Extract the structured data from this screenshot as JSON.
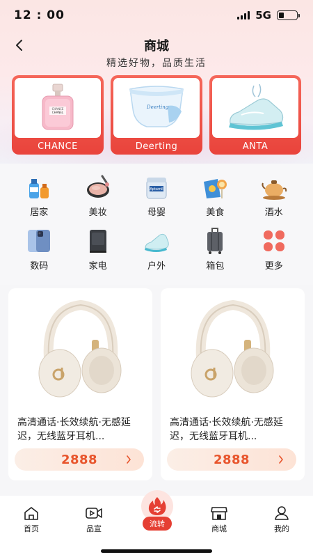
{
  "status_bar": {
    "time": "12 : 00",
    "network": "5G"
  },
  "header": {
    "title": "商城",
    "subtitle": "精选好物，品质生活"
  },
  "brands": [
    {
      "label": "CHANCE",
      "icon": "perfume-bottle-image"
    },
    {
      "label": "Deerting",
      "icon": "diaper-image"
    },
    {
      "label": "ANTA",
      "icon": "sneaker-image"
    }
  ],
  "categories": [
    {
      "label": "居家",
      "icon": "household-icon"
    },
    {
      "label": "美妆",
      "icon": "makeup-icon"
    },
    {
      "label": "母婴",
      "icon": "baby-formula-icon"
    },
    {
      "label": "美食",
      "icon": "snack-icon"
    },
    {
      "label": "酒水",
      "icon": "teapot-icon"
    },
    {
      "label": "数码",
      "icon": "phone-icon"
    },
    {
      "label": "家电",
      "icon": "appliance-icon"
    },
    {
      "label": "户外",
      "icon": "outdoor-shoe-icon"
    },
    {
      "label": "箱包",
      "icon": "luggage-icon"
    },
    {
      "label": "更多",
      "icon": "more-icon"
    }
  ],
  "products": [
    {
      "title": "高清通话·长效续航·无感延迟，无线蓝牙耳机...",
      "price": "2888"
    },
    {
      "title": "高清通话·长效续航·无感延迟，无线蓝牙耳机...",
      "price": "2888"
    }
  ],
  "tabbar": {
    "items": [
      {
        "label": "首页",
        "icon": "home-icon"
      },
      {
        "label": "品宣",
        "icon": "video-icon"
      },
      {
        "label": "流转",
        "icon": "flame-icon"
      },
      {
        "label": "商城",
        "icon": "store-icon"
      },
      {
        "label": "我的",
        "icon": "user-icon"
      }
    ]
  },
  "colors": {
    "accent": "#e9433b",
    "price": "#e8552c",
    "background": "#f6f6f8"
  }
}
